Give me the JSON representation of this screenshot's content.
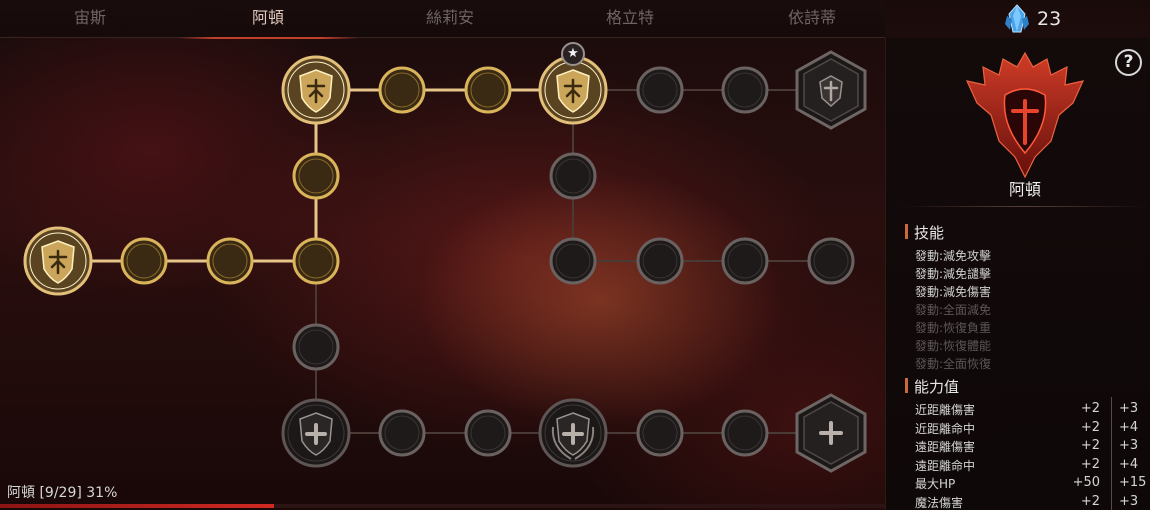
{
  "tabs": [
    {
      "label": "宙斯"
    },
    {
      "label": "阿頓"
    },
    {
      "label": "絲莉安"
    },
    {
      "label": "格立特"
    },
    {
      "label": "依詩蒂"
    }
  ],
  "active_tab": "阿頓",
  "currency": {
    "icon": "crystal-icon",
    "value": "23"
  },
  "panel": {
    "class_name": "阿頓",
    "skills_title": "技能",
    "skills": [
      {
        "label": "發動:減免攻擊",
        "active": true
      },
      {
        "label": "發動:減免譴擊",
        "active": true
      },
      {
        "label": "發動:減免傷害",
        "active": true
      },
      {
        "label": "發動:全面減免",
        "active": false
      },
      {
        "label": "發動:恢復負重",
        "active": false
      },
      {
        "label": "發動:恢復體能",
        "active": false
      },
      {
        "label": "發動:全面恢復",
        "active": false
      }
    ],
    "stats_title": "能力值",
    "stats": [
      {
        "name": "近距離傷害",
        "current": "+2",
        "max": "+3"
      },
      {
        "name": "近距離命中",
        "current": "+2",
        "max": "+4"
      },
      {
        "name": "遠距離傷害",
        "current": "+2",
        "max": "+3"
      },
      {
        "name": "遠距離命中",
        "current": "+2",
        "max": "+4"
      },
      {
        "name": "最大HP",
        "current": "+50",
        "max": "+15"
      },
      {
        "name": "魔法傷害",
        "current": "+2",
        "max": "+3"
      }
    ]
  },
  "progress": {
    "text": "阿頓 [9/29] 31%",
    "fraction": 0.31
  },
  "colors": {
    "accent": "#c0402b",
    "gold": "#d9b45a",
    "dim": "#5b5554"
  },
  "tree_nodes": [
    {
      "id": "root",
      "kind": "big",
      "icon": "shield-figure-icon",
      "lit": true
    },
    {
      "id": "r1",
      "kind": "small",
      "icon": "crescent-icon",
      "lit": true
    },
    {
      "id": "r2",
      "kind": "small",
      "icon": "crescent-icon",
      "lit": true
    },
    {
      "id": "junction",
      "kind": "small",
      "icon": "crescent-icon",
      "lit": true
    },
    {
      "id": "up1",
      "kind": "small",
      "icon": "crescent-icon",
      "lit": true
    },
    {
      "id": "top-shield",
      "kind": "big",
      "icon": "shield-figure-icon",
      "lit": true
    },
    {
      "id": "t1",
      "kind": "small",
      "icon": "crescent-icon",
      "lit": true
    },
    {
      "id": "t2",
      "kind": "small",
      "icon": "crescent-icon",
      "lit": true
    },
    {
      "id": "star-shield",
      "kind": "big",
      "icon": "shield-figure-icon",
      "lit": true,
      "starred": true
    },
    {
      "id": "t3",
      "kind": "small",
      "icon": "crescent-icon",
      "lit": false
    },
    {
      "id": "t4",
      "kind": "small",
      "icon": "crescent-icon",
      "lit": false
    },
    {
      "id": "top-hex",
      "kind": "hex",
      "icon": "crest-icon",
      "lit": false
    },
    {
      "id": "m1",
      "kind": "small",
      "icon": "crescent-icon",
      "lit": false
    },
    {
      "id": "m2",
      "kind": "small",
      "icon": "crescent-icon",
      "lit": false
    },
    {
      "id": "m3",
      "kind": "small",
      "icon": "crescent-icon",
      "lit": false
    },
    {
      "id": "m4",
      "kind": "small",
      "icon": "crescent-icon",
      "lit": false
    },
    {
      "id": "m5",
      "kind": "small",
      "icon": "crescent-icon",
      "lit": false
    },
    {
      "id": "down1",
      "kind": "small",
      "icon": "crescent-icon",
      "lit": false
    },
    {
      "id": "bottom-shield",
      "kind": "big",
      "icon": "shield-cross-icon",
      "lit": false
    },
    {
      "id": "b1",
      "kind": "small",
      "icon": "crescent-icon",
      "lit": false
    },
    {
      "id": "b2",
      "kind": "small",
      "icon": "crescent-icon",
      "lit": false
    },
    {
      "id": "bottom-wreath",
      "kind": "big",
      "icon": "shield-cross-wreath-icon",
      "lit": false
    },
    {
      "id": "b3",
      "kind": "small",
      "icon": "crescent-icon",
      "lit": false
    },
    {
      "id": "b4",
      "kind": "small",
      "icon": "crescent-icon",
      "lit": false
    },
    {
      "id": "bottom-hex",
      "kind": "hex",
      "icon": "crest-cross-icon",
      "lit": false
    }
  ]
}
